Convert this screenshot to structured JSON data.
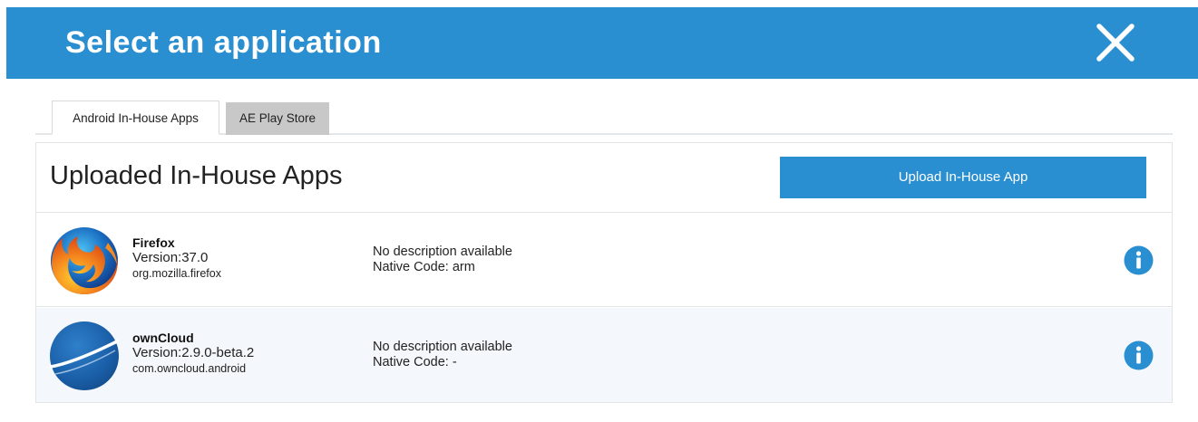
{
  "dialog": {
    "title": "Select an application",
    "close_icon": "close-icon"
  },
  "tabs": [
    {
      "label": "Android In-House Apps",
      "active": true
    },
    {
      "label": "AE Play Store",
      "active": false
    }
  ],
  "panel": {
    "title": "Uploaded In-House Apps",
    "upload_button": "Upload In-House App"
  },
  "apps": [
    {
      "name": "Firefox",
      "version": "Version:37.0",
      "package": "org.mozilla.firefox",
      "description": "No description available",
      "native_code": "Native Code: arm",
      "icon": "firefox-icon"
    },
    {
      "name": "ownCloud",
      "version": "Version:2.9.0-beta.2",
      "package": "com.owncloud.android",
      "description": "No description available",
      "native_code": "Native Code: -",
      "icon": "owncloud-icon"
    }
  ],
  "colors": {
    "accent": "#2a8fd0",
    "inactive_tab": "#c8c8c8",
    "row_alt": "#f4f8fc"
  }
}
